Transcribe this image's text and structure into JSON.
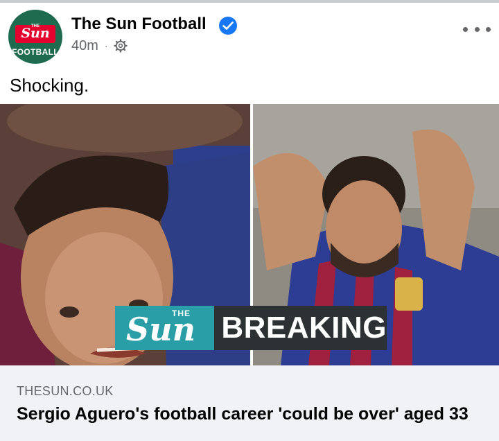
{
  "post": {
    "avatar": {
      "brand_the": "THE",
      "brand_word": "Sun",
      "label": "FOOTBALL"
    },
    "page_name": "The Sun Football",
    "verified_icon": "verified-badge-icon",
    "timestamp": "40m",
    "separator": "·",
    "audience_icon": "gear-icon",
    "more_icon": "more-options-icon",
    "caption": "Shocking."
  },
  "media": {
    "banner": {
      "the": "THE",
      "brand": "Sun",
      "label": "BREAKING"
    },
    "colors": {
      "sun_teal": "#2a9ea6",
      "breaking_dark": "#2c3134",
      "sun_red": "#e4032e",
      "avatar_green": "#1f6b4f"
    }
  },
  "link": {
    "domain": "THESUN.CO.UK",
    "headline": "Sergio Aguero's football career 'could be over' aged 33"
  }
}
